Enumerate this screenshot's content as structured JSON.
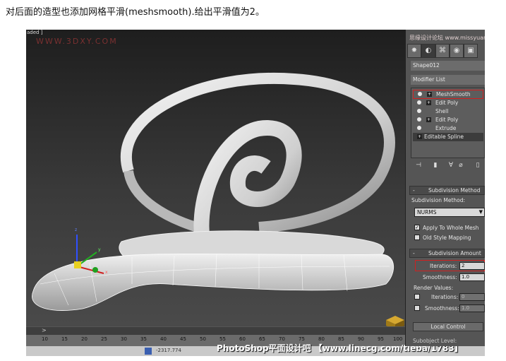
{
  "caption": "对后面的造型也添加网格平滑(meshsmooth).给出平滑值为2。",
  "viewport": {
    "label": "aded ]",
    "watermark": "WWW.3DXY.COM",
    "gizmo": {
      "z": "z",
      "x": "x",
      "y": "y"
    }
  },
  "panel": {
    "watermark": "思缘设计论坛 www.missyuan.com",
    "tabs": [
      "create-icon",
      "modify-icon",
      "hierarchy-icon",
      "motion-icon",
      "display-icon"
    ],
    "object_name": "Shape012",
    "modifier_list": "Modifier List",
    "stack": [
      {
        "name": "MeshSmooth",
        "expand": "+"
      },
      {
        "name": "Edit Poly",
        "expand": "+"
      },
      {
        "name": "Shell",
        "expand": ""
      },
      {
        "name": "Edit Poly",
        "expand": "+"
      },
      {
        "name": "Extrude",
        "expand": ""
      },
      {
        "name": "Editable Spline",
        "expand": "+"
      }
    ],
    "subdiv_method": {
      "header": "Subdivision Method",
      "label": "Subdivision Method:",
      "value": "NURMS",
      "apply_whole": "Apply To Whole Mesh",
      "old_style": "Old Style Mapping"
    },
    "subdiv_amount": {
      "header": "Subdivision Amount",
      "iterations_label": "Iterations:",
      "iterations_value": "2",
      "smoothness_label": "Smoothness:",
      "smoothness_value": "1.0",
      "render_values": "Render Values:",
      "render_iterations_label": "Iterations:",
      "render_iterations_value": "0",
      "render_smoothness_label": "Smoothness:",
      "render_smoothness_value": "1.0"
    },
    "local_control": "Local Control",
    "subobject_level": "Subobject Level:"
  },
  "timeline": {
    "arrow": ">",
    "ticks": [
      "10",
      "15",
      "20",
      "25",
      "30",
      "35",
      "40",
      "45",
      "50",
      "55",
      "60",
      "65",
      "70",
      "75",
      "80",
      "85",
      "90",
      "95",
      "100"
    ]
  },
  "status": {
    "text": "-2317.774"
  },
  "footer_brand": "PhotoShop平面设计吧 【www.linecg.com/tieba/1783】"
}
